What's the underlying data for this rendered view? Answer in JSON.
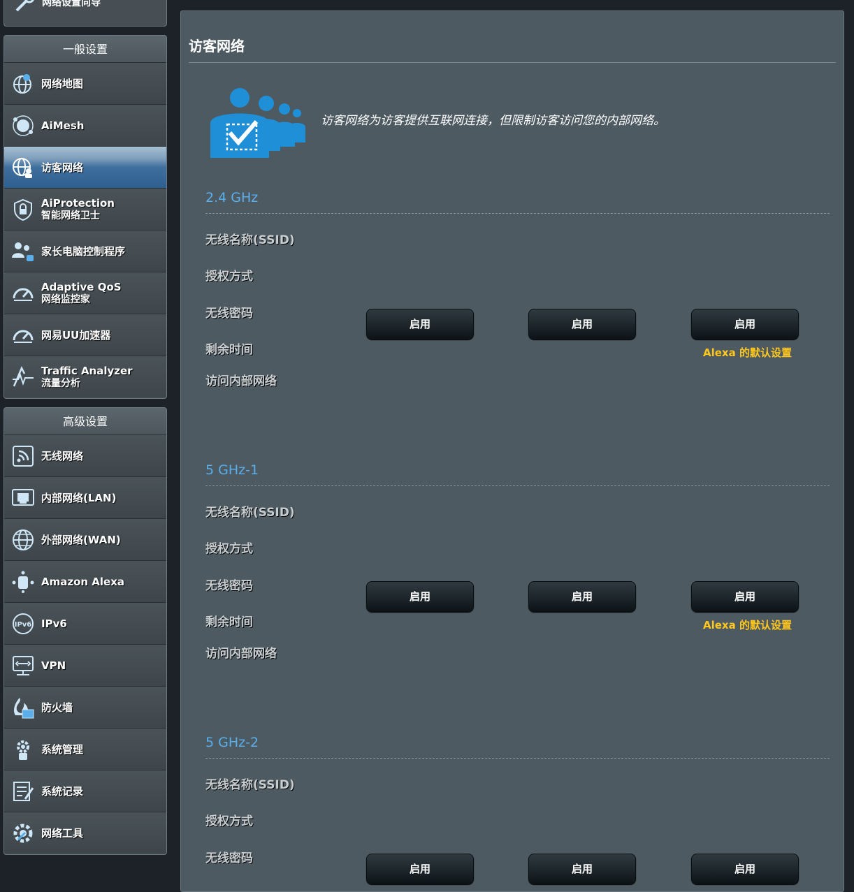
{
  "sidebar": {
    "top_item": "网络设置向导",
    "general": {
      "header": "一般设置",
      "items": [
        {
          "label": "网络地图",
          "sub": "",
          "icon": "network-map-icon"
        },
        {
          "label": "AiMesh",
          "sub": "",
          "icon": "aimesh-icon"
        },
        {
          "label": "访客网络",
          "sub": "",
          "icon": "guest-network-icon",
          "active": true
        },
        {
          "label": "AiProtection",
          "sub": "智能网络卫士",
          "icon": "shield-lock-icon"
        },
        {
          "label": "家长电脑控制程序",
          "sub": "",
          "icon": "parental-control-icon"
        },
        {
          "label": "Adaptive QoS",
          "sub": "网络监控家",
          "icon": "speedometer-icon"
        },
        {
          "label": "网易UU加速器",
          "sub": "",
          "icon": "speedometer-icon"
        },
        {
          "label": "Traffic Analyzer",
          "sub": "流量分析",
          "icon": "traffic-analyzer-icon"
        }
      ]
    },
    "advanced": {
      "header": "高级设置",
      "items": [
        {
          "label": "无线网络",
          "icon": "wireless-icon"
        },
        {
          "label": "内部网络(LAN)",
          "icon": "lan-icon"
        },
        {
          "label": "外部网络(WAN)",
          "icon": "wan-globe-icon"
        },
        {
          "label": "Amazon Alexa",
          "icon": "alexa-icon"
        },
        {
          "label": "IPv6",
          "icon": "ipv6-icon"
        },
        {
          "label": "VPN",
          "icon": "vpn-icon"
        },
        {
          "label": "防火墙",
          "icon": "firewall-icon"
        },
        {
          "label": "系统管理",
          "icon": "admin-gear-icon"
        },
        {
          "label": "系统记录",
          "icon": "system-log-icon"
        },
        {
          "label": "网络工具",
          "icon": "network-tools-icon"
        }
      ]
    }
  },
  "main": {
    "title": "访客网络",
    "intro": "访客网络为访客提供互联网连接，但限制访客访问您的内部网络。",
    "row_labels": {
      "ssid": "无线名称(SSID)",
      "auth": "授权方式",
      "password": "无线密码",
      "remaining": "剩余时间",
      "intranet": "访问内部网络"
    },
    "enable_label": "启用",
    "alexa_note": "Alexa 的默认设置",
    "bands": [
      {
        "title": "2.4 GHz"
      },
      {
        "title": "5 GHz-1"
      },
      {
        "title": "5 GHz-2"
      }
    ]
  }
}
